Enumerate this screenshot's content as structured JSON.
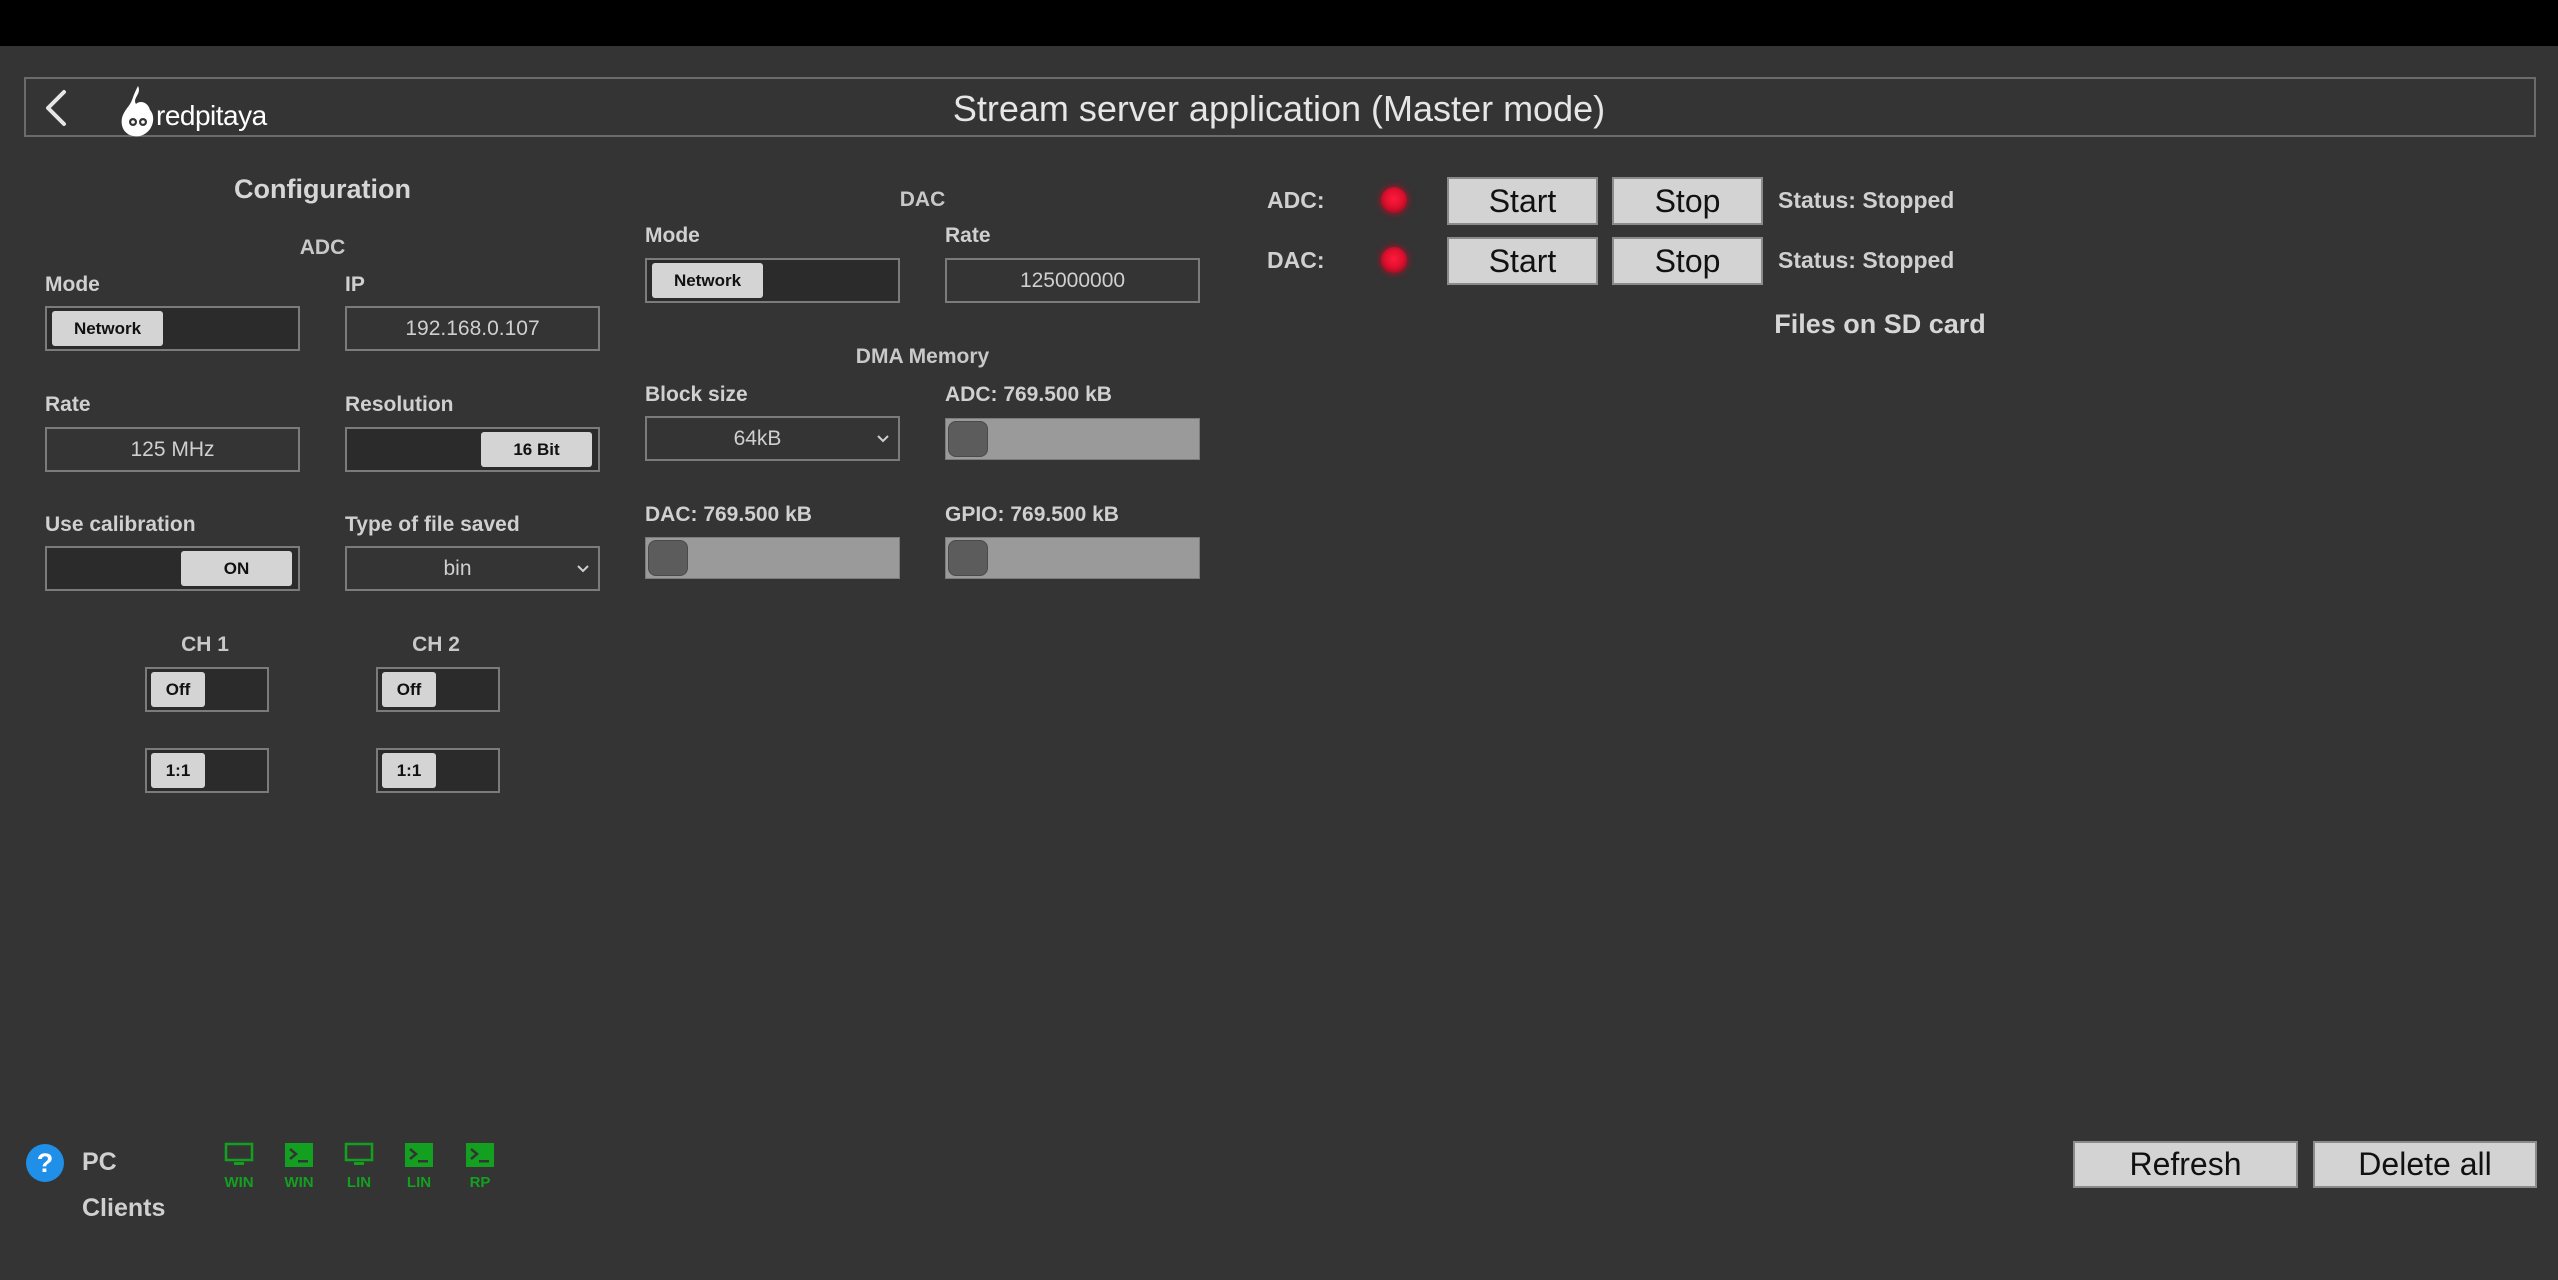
{
  "header": {
    "title": "Stream server application (Master mode)",
    "logo_text": "redpitaya"
  },
  "config": {
    "heading": "Configuration",
    "adc": {
      "heading": "ADC",
      "mode_label": "Mode",
      "mode_value": "Network",
      "ip_label": "IP",
      "ip_value": "192.168.0.107",
      "rate_label": "Rate",
      "rate_value": "125 MHz",
      "resolution_label": "Resolution",
      "resolution_value": "16 Bit",
      "calibration_label": "Use calibration",
      "calibration_value": "ON",
      "filetype_label": "Type of file saved",
      "filetype_value": "bin",
      "ch1_label": "CH 1",
      "ch1_state": "Off",
      "ch1_attenuation": "1:1",
      "ch2_label": "CH 2",
      "ch2_state": "Off",
      "ch2_attenuation": "1:1"
    },
    "dac": {
      "heading": "DAC",
      "mode_label": "Mode",
      "mode_value": "Network",
      "rate_label": "Rate",
      "rate_value": "125000000"
    },
    "dma": {
      "heading": "DMA Memory",
      "block_size_label": "Block size",
      "block_size_value": "64kB",
      "adc_label": "ADC: 769.500 kB",
      "dac_label": "DAC: 769.500 kB",
      "gpio_label": "GPIO: 769.500 kB"
    }
  },
  "control": {
    "adc_label": "ADC:",
    "dac_label": "DAC:",
    "start_label": "Start",
    "stop_label": "Stop",
    "adc_status": "Status: Stopped",
    "dac_status": "Status: Stopped",
    "led_color": "#e0102e"
  },
  "files": {
    "heading": "Files on SD card",
    "refresh_label": "Refresh",
    "delete_all_label": "Delete all"
  },
  "footer": {
    "help_symbol": "?",
    "pc_label": "PC",
    "clients_label": "Clients",
    "clients": [
      {
        "label": "WIN",
        "icon": "monitor-icon"
      },
      {
        "label": "WIN",
        "icon": "terminal-icon"
      },
      {
        "label": "LIN",
        "icon": "monitor-icon"
      },
      {
        "label": "LIN",
        "icon": "terminal-icon"
      },
      {
        "label": "RP",
        "icon": "terminal-icon"
      }
    ],
    "client_color": "#13a021"
  }
}
